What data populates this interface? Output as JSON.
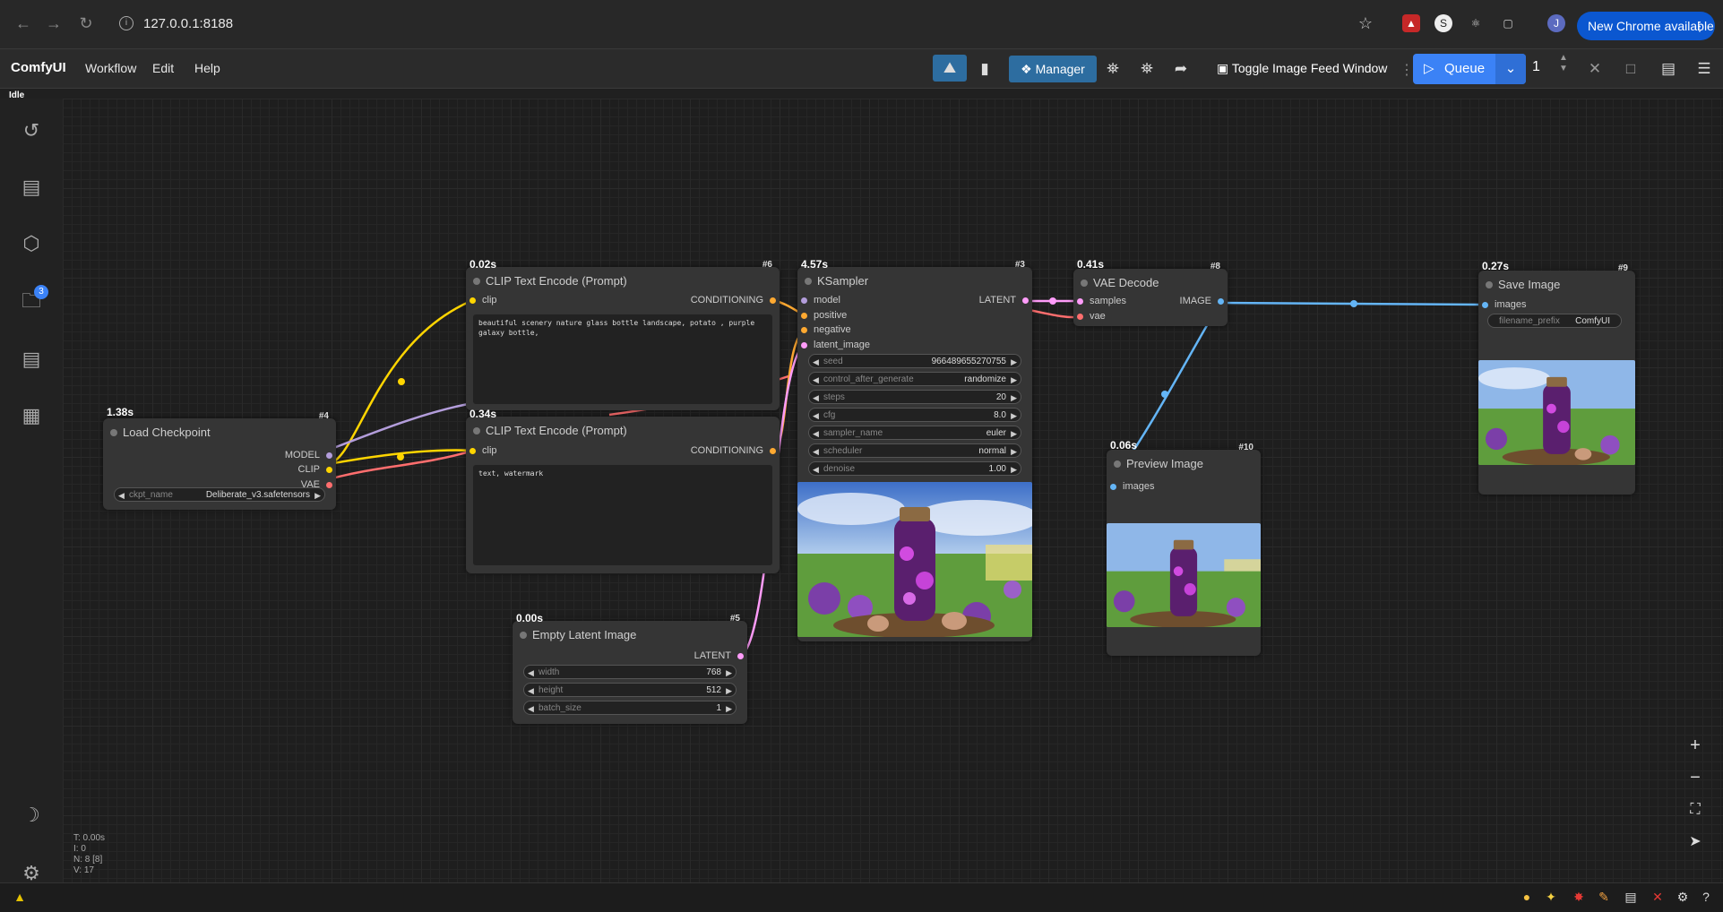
{
  "browser": {
    "url": "127.0.0.1:8188",
    "update_label": "New Chrome available",
    "profile_initial": "J"
  },
  "app": {
    "name": "ComfyUI",
    "menus": [
      "Workflow",
      "Edit",
      "Help"
    ],
    "status": "Idle"
  },
  "toolbar": {
    "manager_label": "Manager",
    "toggle_feed_label": "Toggle Image Feed Window",
    "queue_label": "Queue",
    "queue_count": "1"
  },
  "sidebar": {
    "queue_badge": "3"
  },
  "nodes": {
    "load_checkpoint": {
      "title": "Load Checkpoint",
      "id": "#4",
      "time": "1.38s",
      "outputs": [
        "MODEL",
        "CLIP",
        "VAE"
      ],
      "widget_label": "ckpt_name",
      "widget_value": "Deliberate_v3.safetensors"
    },
    "clip_pos": {
      "title": "CLIP Text Encode (Prompt)",
      "id": "#6",
      "time": "0.02s",
      "input": "clip",
      "output": "CONDITIONING",
      "text": "beautiful scenery nature glass bottle landscape, potato , purple galaxy bottle,"
    },
    "clip_neg": {
      "title": "CLIP Text Encode (Prompt)",
      "time": "0.34s",
      "input": "clip",
      "output": "CONDITIONING",
      "text": "text, watermark"
    },
    "ksampler": {
      "title": "KSampler",
      "id": "#3",
      "time": "4.57s",
      "inputs": [
        "model",
        "positive",
        "negative",
        "latent_image"
      ],
      "output": "LATENT",
      "widgets": [
        {
          "label": "seed",
          "value": "966489655270755"
        },
        {
          "label": "control_after_generate",
          "value": "randomize"
        },
        {
          "label": "steps",
          "value": "20"
        },
        {
          "label": "cfg",
          "value": "8.0"
        },
        {
          "label": "sampler_name",
          "value": "euler"
        },
        {
          "label": "scheduler",
          "value": "normal"
        },
        {
          "label": "denoise",
          "value": "1.00"
        }
      ]
    },
    "vae_decode": {
      "title": "VAE Decode",
      "id": "#8",
      "time": "0.41s",
      "inputs": [
        "samples",
        "vae"
      ],
      "output": "IMAGE"
    },
    "save_image": {
      "title": "Save Image",
      "id": "#9",
      "time": "0.27s",
      "input": "images",
      "widget_label": "filename_prefix",
      "widget_value": "ComfyUI"
    },
    "preview_image": {
      "title": "Preview Image",
      "id": "#10",
      "time": "0.06s",
      "input": "images"
    },
    "empty_latent": {
      "title": "Empty Latent Image",
      "id": "#5",
      "time": "0.00s",
      "output": "LATENT",
      "widgets": [
        {
          "label": "width",
          "value": "768"
        },
        {
          "label": "height",
          "value": "512"
        },
        {
          "label": "batch_size",
          "value": "1"
        }
      ]
    }
  },
  "stats": {
    "t": "T: 0.00s",
    "i": "I: 0",
    "n": "N: 8 [8]",
    "v": "V: 17"
  },
  "colors": {
    "clip": "#ffd500",
    "model": "#b39ddb",
    "vae": "#ff6e6e",
    "conditioning": "#ffa931",
    "latent": "#ff9cf9",
    "image": "#64b5f6",
    "accent": "#3b82f6"
  }
}
